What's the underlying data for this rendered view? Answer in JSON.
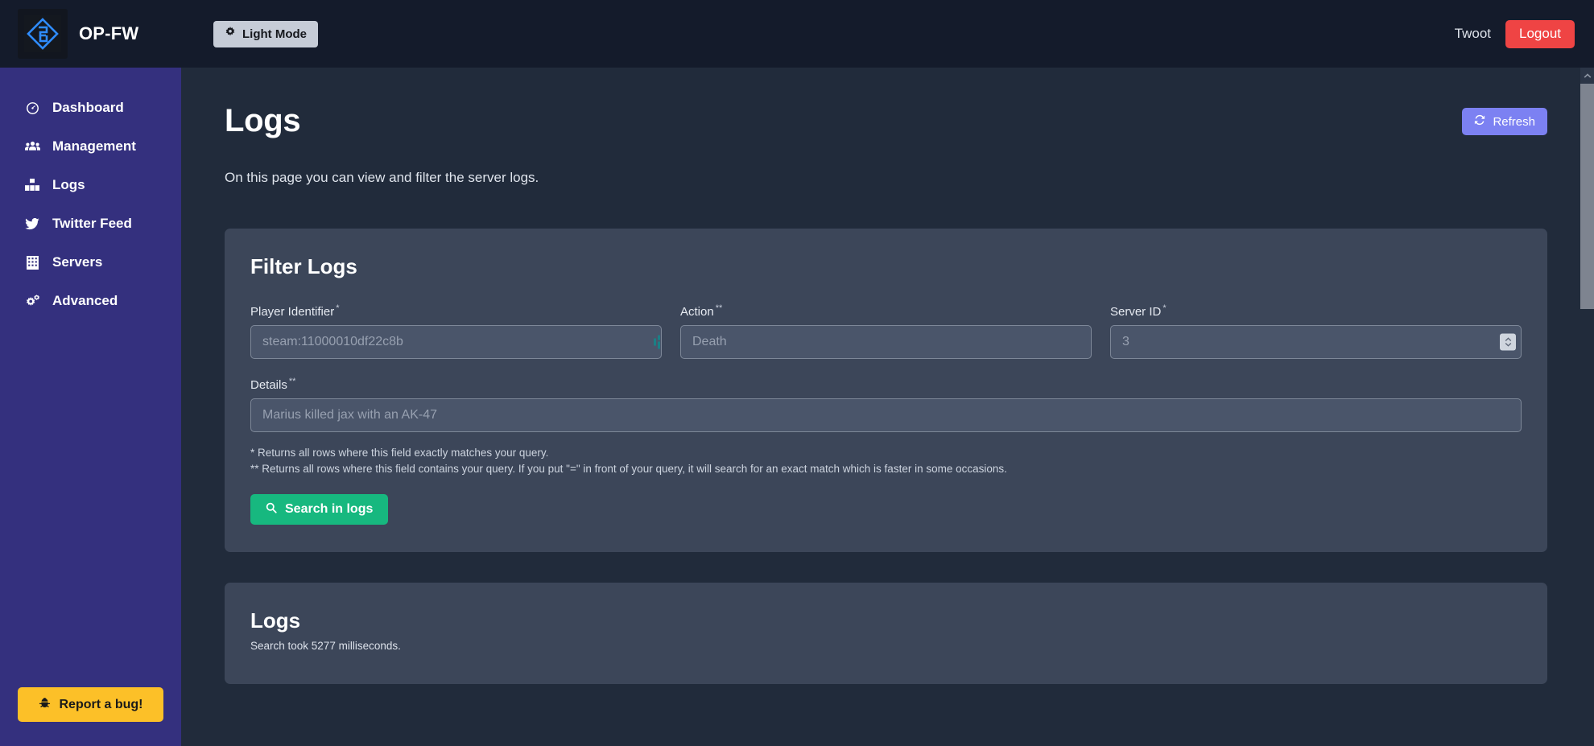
{
  "topbar": {
    "brand_name": "OP-FW",
    "logo_icon": "op-fw-diamond-logo",
    "mode_toggle": {
      "label": "Light Mode",
      "icon": "gear-icon"
    },
    "user_name": "Twoot",
    "logout_label": "Logout",
    "logout_color": "#ef4444"
  },
  "sidebar": {
    "bg_color": "#34307e",
    "items": [
      {
        "label": "Dashboard",
        "icon": "dashboard-gauge-icon"
      },
      {
        "label": "Management",
        "icon": "users-group-icon"
      },
      {
        "label": "Logs",
        "icon": "logs-bars-icon"
      },
      {
        "label": "Twitter Feed",
        "icon": "twitter-bird-icon"
      },
      {
        "label": "Servers",
        "icon": "servers-grid-icon"
      },
      {
        "label": "Advanced",
        "icon": "gears-icon"
      }
    ],
    "bug_button": {
      "label": "Report a bug!",
      "icon": "bug-icon",
      "color": "#fcc028"
    }
  },
  "page": {
    "title": "Logs",
    "description": "On this page you can view and filter the server logs.",
    "refresh_button": {
      "label": "Refresh",
      "icon": "refresh-icon",
      "color": "#7c81f2"
    }
  },
  "filter_card": {
    "title": "Filter Logs",
    "fields": [
      {
        "label": "Player Identifier",
        "marker": "*",
        "placeholder": "steam:11000010df22c8b",
        "value": "",
        "type": "text"
      },
      {
        "label": "Action",
        "marker": "**",
        "placeholder": "Death",
        "value": "",
        "type": "text"
      },
      {
        "label": "Server ID",
        "marker": "*",
        "placeholder": "3",
        "value": "",
        "type": "number"
      }
    ],
    "details_field": {
      "label": "Details",
      "marker": "**",
      "placeholder": "Marius killed jax with an AK-47",
      "value": ""
    },
    "note_single": "* Returns all rows where this field exactly matches your query.",
    "note_double": "** Returns all rows where this field contains your query. If you put \"=\" in front of your query, it will search for an exact match which is faster in some occasions.",
    "search_button": {
      "label": "Search in logs",
      "icon": "search-icon",
      "color": "#17b87f"
    }
  },
  "logs_card": {
    "title": "Logs",
    "subtitle": "Search took 5277 milliseconds."
  },
  "scrollbar": {
    "up_arrow_icon": "chevron-up-icon"
  }
}
